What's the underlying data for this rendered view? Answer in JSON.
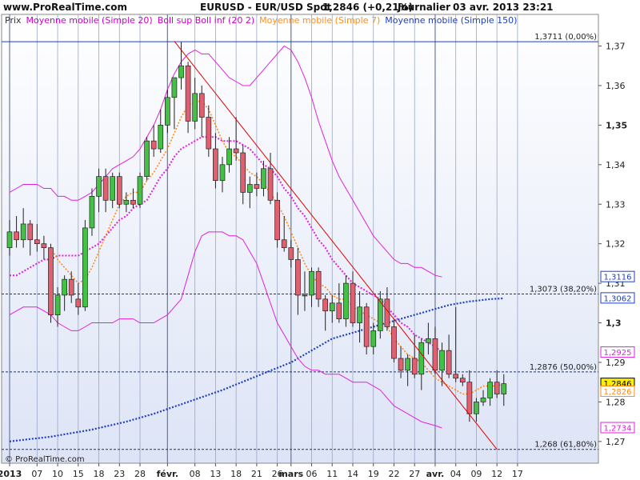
{
  "header": {
    "site": "www.ProRealTime.com",
    "instrument": "EURUSD - EUR/USD Spot",
    "last": "1,2846 (+0,21%)",
    "period": "Journalier",
    "datetime": "03 avr. 2013 23:21"
  },
  "legend": [
    {
      "label": "Prix",
      "color": "#333333"
    },
    {
      "label": "Moyenne mobile (Simple 20)",
      "color": "#cc00cc"
    },
    {
      "label": "Boll sup Boll inf (20 2)",
      "color": "#cc00cc"
    },
    {
      "label": "Moyenne mobile (Simple 7)",
      "color": "#ff8c1a"
    },
    {
      "label": "Moyenne mobile (Simple 150)",
      "color": "#1f3fbf"
    }
  ],
  "copyright": "© ProRealTime.com",
  "colors": {
    "up": "#44c044",
    "down": "#e06070",
    "bollinger": "#e020e0",
    "sma20": "#e020e0",
    "sma7": "#ff8c1a",
    "sma150": "#1f3fbf",
    "trendline": "#e00000",
    "background_gradient_top": "#ffffff",
    "background_gradient_bottom": "#dde4f6"
  },
  "chart_data": {
    "type": "candlestick",
    "y_ticks": [
      {
        "value": 1.27,
        "label": "1,27"
      },
      {
        "value": 1.28,
        "label": "1,28"
      },
      {
        "value": 1.29,
        "label": "1,29"
      },
      {
        "value": 1.3,
        "label": "1,3"
      },
      {
        "value": 1.31,
        "label": "1,31"
      },
      {
        "value": 1.32,
        "label": "1,32"
      },
      {
        "value": 1.33,
        "label": "1,33"
      },
      {
        "value": 1.34,
        "label": "1,34"
      },
      {
        "value": 1.35,
        "label": "1,35"
      },
      {
        "value": 1.36,
        "label": "1,36"
      },
      {
        "value": 1.37,
        "label": "1,37"
      }
    ],
    "ylim": [
      1.2645,
      1.378
    ],
    "x_labels": [
      {
        "bar": 0,
        "label": "2013"
      },
      {
        "bar": 4,
        "label": "07"
      },
      {
        "bar": 7,
        "label": "10"
      },
      {
        "bar": 10,
        "label": "15"
      },
      {
        "bar": 13,
        "label": "18"
      },
      {
        "bar": 16,
        "label": "23"
      },
      {
        "bar": 19,
        "label": "28"
      },
      {
        "bar": 23,
        "label": "févr."
      },
      {
        "bar": 27,
        "label": "08"
      },
      {
        "bar": 30,
        "label": "13"
      },
      {
        "bar": 33,
        "label": "18"
      },
      {
        "bar": 36,
        "label": "21"
      },
      {
        "bar": 39,
        "label": "26"
      },
      {
        "bar": 41,
        "label": "mars"
      },
      {
        "bar": 44,
        "label": "06"
      },
      {
        "bar": 47,
        "label": "11"
      },
      {
        "bar": 50,
        "label": "14"
      },
      {
        "bar": 53,
        "label": "19"
      },
      {
        "bar": 56,
        "label": "22"
      },
      {
        "bar": 59,
        "label": "27"
      },
      {
        "bar": 62,
        "label": "avr."
      },
      {
        "bar": 65,
        "label": "04"
      },
      {
        "bar": 68,
        "label": "09"
      },
      {
        "bar": 71,
        "label": "12"
      },
      {
        "bar": 74,
        "label": "17"
      }
    ],
    "month_separators": [
      0,
      23,
      41,
      62
    ],
    "candles": [
      {
        "o": 1.319,
        "h": 1.326,
        "l": 1.317,
        "c": 1.323
      },
      {
        "o": 1.323,
        "h": 1.327,
        "l": 1.319,
        "c": 1.321
      },
      {
        "o": 1.321,
        "h": 1.329,
        "l": 1.319,
        "c": 1.325
      },
      {
        "o": 1.325,
        "h": 1.326,
        "l": 1.317,
        "c": 1.321
      },
      {
        "o": 1.321,
        "h": 1.325,
        "l": 1.318,
        "c": 1.32
      },
      {
        "o": 1.32,
        "h": 1.322,
        "l": 1.316,
        "c": 1.319
      },
      {
        "o": 1.319,
        "h": 1.32,
        "l": 1.3,
        "c": 1.302
      },
      {
        "o": 1.302,
        "h": 1.309,
        "l": 1.299,
        "c": 1.307
      },
      {
        "o": 1.307,
        "h": 1.312,
        "l": 1.303,
        "c": 1.311
      },
      {
        "o": 1.311,
        "h": 1.313,
        "l": 1.305,
        "c": 1.307
      },
      {
        "o": 1.306,
        "h": 1.31,
        "l": 1.302,
        "c": 1.304
      },
      {
        "o": 1.304,
        "h": 1.326,
        "l": 1.303,
        "c": 1.324
      },
      {
        "o": 1.324,
        "h": 1.334,
        "l": 1.322,
        "c": 1.332
      },
      {
        "o": 1.332,
        "h": 1.339,
        "l": 1.328,
        "c": 1.337
      },
      {
        "o": 1.337,
        "h": 1.339,
        "l": 1.328,
        "c": 1.331
      },
      {
        "o": 1.331,
        "h": 1.338,
        "l": 1.329,
        "c": 1.337
      },
      {
        "o": 1.337,
        "h": 1.338,
        "l": 1.329,
        "c": 1.33
      },
      {
        "o": 1.33,
        "h": 1.333,
        "l": 1.328,
        "c": 1.331
      },
      {
        "o": 1.331,
        "h": 1.334,
        "l": 1.329,
        "c": 1.33
      },
      {
        "o": 1.33,
        "h": 1.338,
        "l": 1.329,
        "c": 1.337
      },
      {
        "o": 1.337,
        "h": 1.347,
        "l": 1.336,
        "c": 1.346
      },
      {
        "o": 1.346,
        "h": 1.35,
        "l": 1.342,
        "c": 1.344
      },
      {
        "o": 1.344,
        "h": 1.354,
        "l": 1.343,
        "c": 1.35
      },
      {
        "o": 1.35,
        "h": 1.359,
        "l": 1.348,
        "c": 1.357
      },
      {
        "o": 1.357,
        "h": 1.361,
        "l": 1.349,
        "c": 1.362
      },
      {
        "o": 1.362,
        "h": 1.371,
        "l": 1.359,
        "c": 1.365
      },
      {
        "o": 1.365,
        "h": 1.366,
        "l": 1.348,
        "c": 1.351
      },
      {
        "o": 1.351,
        "h": 1.362,
        "l": 1.349,
        "c": 1.358
      },
      {
        "o": 1.358,
        "h": 1.36,
        "l": 1.347,
        "c": 1.352
      },
      {
        "o": 1.352,
        "h": 1.355,
        "l": 1.342,
        "c": 1.344
      },
      {
        "o": 1.344,
        "h": 1.348,
        "l": 1.334,
        "c": 1.336
      },
      {
        "o": 1.336,
        "h": 1.342,
        "l": 1.333,
        "c": 1.34
      },
      {
        "o": 1.34,
        "h": 1.347,
        "l": 1.338,
        "c": 1.344
      },
      {
        "o": 1.344,
        "h": 1.352,
        "l": 1.341,
        "c": 1.343
      },
      {
        "o": 1.343,
        "h": 1.345,
        "l": 1.33,
        "c": 1.333
      },
      {
        "o": 1.333,
        "h": 1.337,
        "l": 1.329,
        "c": 1.335
      },
      {
        "o": 1.335,
        "h": 1.338,
        "l": 1.332,
        "c": 1.334
      },
      {
        "o": 1.334,
        "h": 1.341,
        "l": 1.332,
        "c": 1.339
      },
      {
        "o": 1.339,
        "h": 1.343,
        "l": 1.33,
        "c": 1.331
      },
      {
        "o": 1.331,
        "h": 1.333,
        "l": 1.319,
        "c": 1.321
      },
      {
        "o": 1.321,
        "h": 1.327,
        "l": 1.318,
        "c": 1.319
      },
      {
        "o": 1.319,
        "h": 1.321,
        "l": 1.314,
        "c": 1.316
      },
      {
        "o": 1.316,
        "h": 1.319,
        "l": 1.302,
        "c": 1.307
      },
      {
        "o": 1.307,
        "h": 1.313,
        "l": 1.303,
        "c": 1.307
      },
      {
        "o": 1.307,
        "h": 1.314,
        "l": 1.304,
        "c": 1.313
      },
      {
        "o": 1.313,
        "h": 1.314,
        "l": 1.304,
        "c": 1.306
      },
      {
        "o": 1.306,
        "h": 1.307,
        "l": 1.298,
        "c": 1.303
      },
      {
        "o": 1.303,
        "h": 1.307,
        "l": 1.3,
        "c": 1.305
      },
      {
        "o": 1.305,
        "h": 1.31,
        "l": 1.3,
        "c": 1.301
      },
      {
        "o": 1.301,
        "h": 1.312,
        "l": 1.299,
        "c": 1.31
      },
      {
        "o": 1.31,
        "h": 1.313,
        "l": 1.299,
        "c": 1.3
      },
      {
        "o": 1.3,
        "h": 1.308,
        "l": 1.295,
        "c": 1.304
      },
      {
        "o": 1.304,
        "h": 1.305,
        "l": 1.292,
        "c": 1.294
      },
      {
        "o": 1.294,
        "h": 1.3,
        "l": 1.292,
        "c": 1.298
      },
      {
        "o": 1.298,
        "h": 1.308,
        "l": 1.296,
        "c": 1.306
      },
      {
        "o": 1.306,
        "h": 1.309,
        "l": 1.298,
        "c": 1.299
      },
      {
        "o": 1.299,
        "h": 1.301,
        "l": 1.29,
        "c": 1.291
      },
      {
        "o": 1.291,
        "h": 1.294,
        "l": 1.286,
        "c": 1.288
      },
      {
        "o": 1.288,
        "h": 1.292,
        "l": 1.284,
        "c": 1.291
      },
      {
        "o": 1.291,
        "h": 1.297,
        "l": 1.286,
        "c": 1.287
      },
      {
        "o": 1.287,
        "h": 1.296,
        "l": 1.283,
        "c": 1.295
      },
      {
        "o": 1.295,
        "h": 1.3,
        "l": 1.292,
        "c": 1.296
      },
      {
        "o": 1.296,
        "h": 1.299,
        "l": 1.287,
        "c": 1.288
      },
      {
        "o": 1.288,
        "h": 1.295,
        "l": 1.284,
        "c": 1.293
      },
      {
        "o": 1.293,
        "h": 1.297,
        "l": 1.286,
        "c": 1.287
      },
      {
        "o": 1.287,
        "h": 1.304,
        "l": 1.285,
        "c": 1.286
      },
      {
        "o": 1.286,
        "h": 1.287,
        "l": 1.284,
        "c": 1.285
      },
      {
        "o": 1.285,
        "h": 1.288,
        "l": 1.275,
        "c": 1.277
      },
      {
        "o": 1.277,
        "h": 1.281,
        "l": 1.275,
        "c": 1.28
      },
      {
        "o": 1.28,
        "h": 1.283,
        "l": 1.279,
        "c": 1.281
      },
      {
        "o": 1.281,
        "h": 1.286,
        "l": 1.279,
        "c": 1.285
      },
      {
        "o": 1.285,
        "h": 1.288,
        "l": 1.281,
        "c": 1.282
      },
      {
        "o": 1.282,
        "h": 1.287,
        "l": 1.279,
        "c": 1.2846
      }
    ],
    "bollinger_upper": [
      1.333,
      1.334,
      1.335,
      1.335,
      1.335,
      1.334,
      1.334,
      1.332,
      1.332,
      1.331,
      1.331,
      1.332,
      1.333,
      1.335,
      1.337,
      1.339,
      1.34,
      1.341,
      1.342,
      1.344,
      1.347,
      1.35,
      1.354,
      1.359,
      1.363,
      1.366,
      1.368,
      1.369,
      1.368,
      1.368,
      1.366,
      1.364,
      1.362,
      1.361,
      1.36,
      1.36,
      1.362,
      1.364,
      1.366,
      1.368,
      1.37,
      1.369,
      1.366,
      1.362,
      1.357,
      1.351,
      1.346,
      1.341,
      1.337,
      1.334,
      1.331,
      1.328,
      1.325,
      1.322,
      1.32,
      1.318,
      1.316,
      1.315,
      1.315,
      1.314,
      1.314,
      1.313,
      1.312,
      1.3116
    ],
    "bollinger_lower": [
      1.302,
      1.303,
      1.304,
      1.304,
      1.304,
      1.303,
      1.302,
      1.3,
      1.299,
      1.298,
      1.298,
      1.299,
      1.3,
      1.3,
      1.3,
      1.3,
      1.301,
      1.301,
      1.301,
      1.3,
      1.3,
      1.3,
      1.301,
      1.302,
      1.304,
      1.306,
      1.312,
      1.318,
      1.322,
      1.323,
      1.323,
      1.323,
      1.322,
      1.322,
      1.321,
      1.318,
      1.315,
      1.31,
      1.305,
      1.3,
      1.297,
      1.294,
      1.291,
      1.289,
      1.288,
      1.288,
      1.287,
      1.287,
      1.287,
      1.286,
      1.285,
      1.285,
      1.285,
      1.284,
      1.283,
      1.281,
      1.279,
      1.278,
      1.277,
      1.276,
      1.275,
      1.2745,
      1.274,
      1.2734
    ],
    "sma20": [
      1.312,
      1.312,
      1.313,
      1.314,
      1.315,
      1.316,
      1.316,
      1.317,
      1.317,
      1.317,
      1.317,
      1.318,
      1.319,
      1.32,
      1.322,
      1.324,
      1.326,
      1.327,
      1.329,
      1.33,
      1.331,
      1.334,
      1.337,
      1.339,
      1.342,
      1.344,
      1.345,
      1.346,
      1.347,
      1.347,
      1.347,
      1.346,
      1.346,
      1.346,
      1.345,
      1.344,
      1.342,
      1.34,
      1.339,
      1.337,
      1.334,
      1.332,
      1.329,
      1.327,
      1.324,
      1.321,
      1.319,
      1.316,
      1.314,
      1.312,
      1.31,
      1.309,
      1.308,
      1.307,
      1.306,
      1.304,
      1.302,
      1.3,
      1.299,
      1.297,
      1.296,
      1.295,
      1.294,
      1.2925
    ],
    "sma7": [
      null,
      null,
      null,
      null,
      null,
      null,
      1.319,
      1.316,
      1.314,
      1.312,
      1.31,
      1.311,
      1.314,
      1.318,
      1.322,
      1.326,
      1.33,
      1.332,
      1.333,
      1.333,
      1.336,
      1.338,
      1.341,
      1.344,
      1.348,
      1.352,
      1.355,
      1.356,
      1.356,
      1.354,
      1.35,
      1.346,
      1.343,
      1.342,
      1.34,
      1.338,
      1.337,
      1.335,
      1.333,
      1.33,
      1.327,
      1.323,
      1.319,
      1.315,
      1.312,
      1.31,
      1.309,
      1.307,
      1.306,
      1.306,
      1.304,
      1.303,
      1.302,
      1.301,
      1.3,
      1.299,
      1.296,
      1.294,
      1.292,
      1.291,
      1.29,
      1.288,
      1.286,
      1.285,
      1.284,
      1.283,
      1.282,
      1.282,
      1.283,
      1.284,
      1.284,
      1.284,
      1.2846
    ],
    "sma150": [
      1.27,
      1.2702,
      1.2704,
      1.2706,
      1.2708,
      1.271,
      1.2712,
      1.2715,
      1.2718,
      1.2721,
      1.2724,
      1.2727,
      1.273,
      1.2734,
      1.2738,
      1.2742,
      1.2746,
      1.275,
      1.2755,
      1.276,
      1.2765,
      1.277,
      1.2776,
      1.2782,
      1.2788,
      1.2794,
      1.28,
      1.2806,
      1.2812,
      1.2818,
      1.2824,
      1.283,
      1.2837,
      1.2844,
      1.2851,
      1.2858,
      1.2865,
      1.2872,
      1.2879,
      1.2886,
      1.2893,
      1.29,
      1.291,
      1.292,
      1.293,
      1.294,
      1.295,
      1.296,
      1.2965,
      1.297,
      1.2975,
      1.298,
      1.2985,
      1.299,
      1.2995,
      1.3,
      1.3005,
      1.301,
      1.3015,
      1.302,
      1.3025,
      1.303,
      1.3035,
      1.304,
      1.3045,
      1.3048,
      1.3051,
      1.3054,
      1.3056,
      1.3058,
      1.306,
      1.3061,
      1.3062
    ],
    "trendline": {
      "from": {
        "bar": 24,
        "value": 1.3712
      },
      "to": {
        "bar": 71,
        "value": 1.268
      }
    },
    "fibonacci_levels": [
      {
        "value": 1.3711,
        "label": "1,3711 (0,00%)"
      },
      {
        "value": 1.3073,
        "label": "1,3073 (38,20%)"
      },
      {
        "value": 1.2876,
        "label": "1,2876 (50,00%)"
      },
      {
        "value": 1.268,
        "label": "1,268 (61,80%)"
      }
    ],
    "price_tags": [
      {
        "value": 1.3116,
        "label": "1,3116",
        "color": "#1f3fbf",
        "bg": "#ffffff"
      },
      {
        "value": 1.3062,
        "label": "1,3062",
        "color": "#1f3fbf",
        "bg": "#ffffff"
      },
      {
        "value": 1.2925,
        "label": "1,2925",
        "color": "#e020e0",
        "bg": "#ffffff"
      },
      {
        "value": 1.2846,
        "label": "1,2846",
        "color": "#000000",
        "bg": "#ffee00"
      },
      {
        "value": 1.2826,
        "label": "1,2826",
        "color": "#ff8c1a",
        "bg": "#ffffff"
      },
      {
        "value": 1.2734,
        "label": "1,2734",
        "color": "#e020e0",
        "bg": "#ffffff"
      }
    ]
  }
}
